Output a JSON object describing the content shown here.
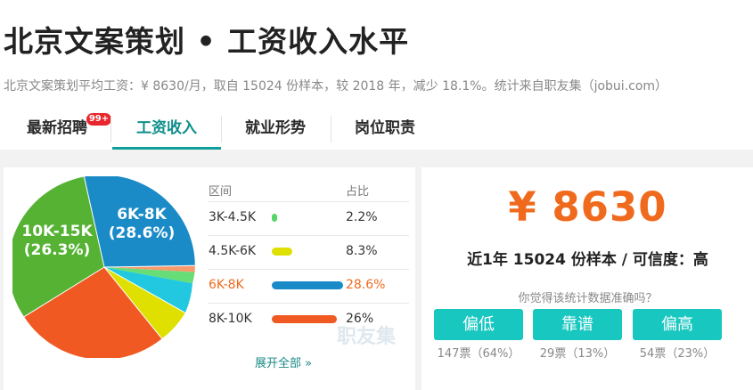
{
  "header": {
    "title": "北京文案策划 • 工资收入水平",
    "subtitle": "北京文案策划平均工资：¥ 8630/月，取自 15024 份样本，较 2018 年，减少 18.1%。统计来自职友集（jobui.com）"
  },
  "tabs": [
    {
      "label": "最新招聘",
      "badge": "99+"
    },
    {
      "label": "工资收入",
      "active": true
    },
    {
      "label": "就业形势"
    },
    {
      "label": "岗位职责"
    }
  ],
  "chart_data": {
    "type": "pie",
    "categories": [
      "6K-8K",
      "8K-10K",
      "10K-15K",
      "4.5K-6K",
      "3K-4.5K"
    ],
    "values": [
      28.6,
      26,
      26.3,
      8.3,
      2.2
    ],
    "labels": [
      {
        "range": "6K-8K",
        "pct": "(28.6%)"
      },
      {
        "range": "10K-15K",
        "pct": "(26.3%)"
      }
    ]
  },
  "table": {
    "headers": [
      "区间",
      "占比"
    ],
    "rows": [
      {
        "range": "3K-4.5K",
        "pct": "2.2%",
        "value": 2.2,
        "color": "#55d56a"
      },
      {
        "range": "4.5K-6K",
        "pct": "8.3%",
        "value": 8.3,
        "color": "#dfe000"
      },
      {
        "range": "6K-8K",
        "pct": "28.6%",
        "value": 28.6,
        "color": "#1b8bc8",
        "highlight": true
      },
      {
        "range": "8K-10K",
        "pct": "26%",
        "value": 26,
        "color": "#f05a22"
      }
    ],
    "expand_label": "展开全部 »"
  },
  "watermark": "职友集",
  "summary": {
    "salary": "¥ 8630",
    "sample_text": "近1年 15024 份样本 / 可信度：高",
    "question": "你觉得该统计数据准确吗？"
  },
  "votes": [
    {
      "label": "偏低",
      "count": "147票（64%）"
    },
    {
      "label": "靠谱",
      "count": "29票（13%）"
    },
    {
      "label": "偏高",
      "count": "54票（23%）"
    }
  ],
  "colors": {
    "accent_teal": "#17c7c0",
    "salary_orange": "#f06a1e",
    "badge_red": "#e8262d",
    "pie_blue": "#1b8bc8",
    "pie_orange": "#f05a22",
    "pie_green": "#55b233",
    "pie_yellow": "#dfe000",
    "pie_cyan": "#22c8e0",
    "pie_lightgreen": "#66dd77",
    "pie_salmon": "#f79a6c"
  }
}
